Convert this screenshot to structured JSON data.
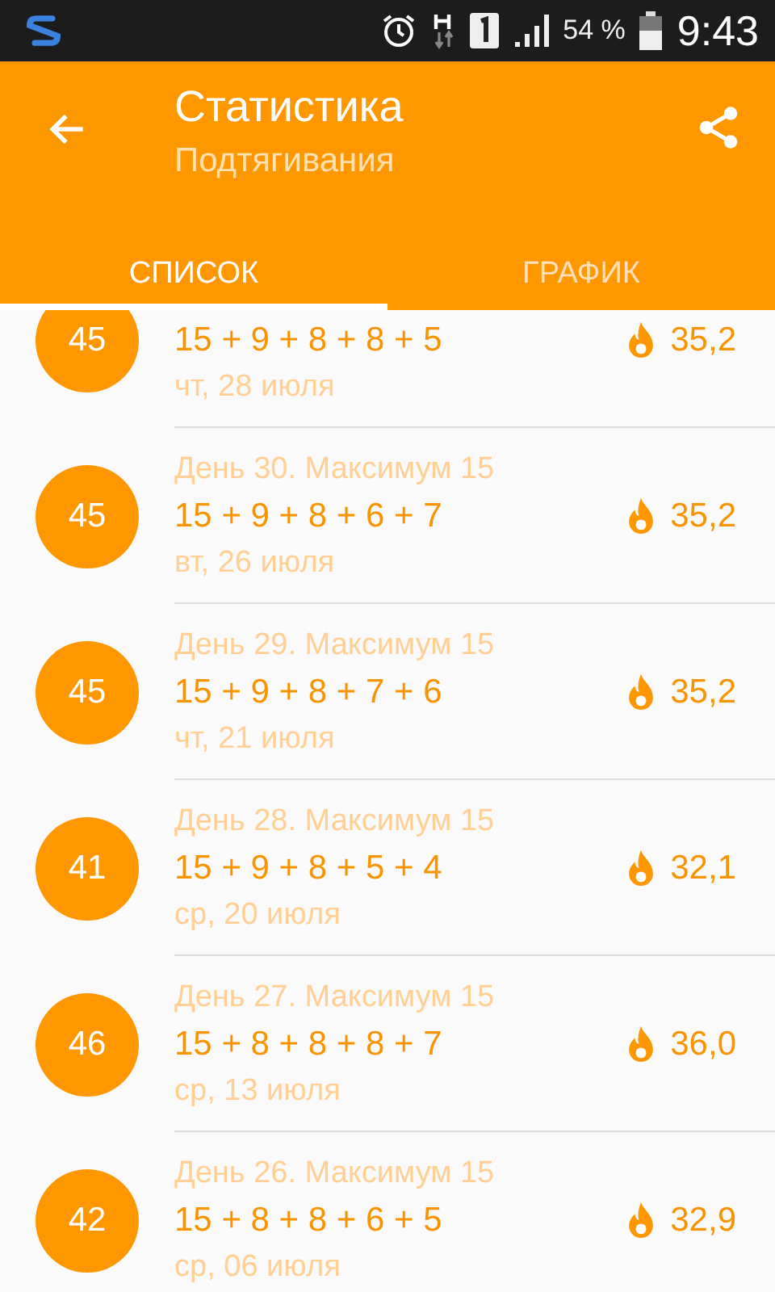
{
  "status_bar": {
    "battery_text": "54 %",
    "time": "9:43"
  },
  "app_bar": {
    "title": "Статистика",
    "subtitle": "Подтягивания"
  },
  "tabs": [
    {
      "label": "СПИСОК",
      "selected": true
    },
    {
      "label": "ГРАФИК",
      "selected": false
    }
  ],
  "entries": [
    {
      "total": "45",
      "sets": "15 + 9 + 8 + 8 + 5",
      "date": "чт, 28 июля",
      "score": "35,2"
    },
    {
      "total": "45",
      "header": "День 30.  Максимум 15",
      "sets": "15 + 9 + 8 + 6 + 7",
      "date": "вт, 26 июля",
      "score": "35,2"
    },
    {
      "total": "45",
      "header": "День 29.  Максимум 15",
      "sets": "15 + 9 + 8 + 7 + 6",
      "date": "чт, 21 июля",
      "score": "35,2"
    },
    {
      "total": "41",
      "header": "День 28.  Максимум 15",
      "sets": "15 + 9 + 8 + 5 + 4",
      "date": "ср, 20 июля",
      "score": "32,1"
    },
    {
      "total": "46",
      "header": "День 27.  Максимум 15",
      "sets": "15 + 8 + 8 + 8 + 7",
      "date": "ср, 13 июля",
      "score": "36,0"
    },
    {
      "total": "42",
      "header": "День 26.  Максимум 15",
      "sets": "15 + 8 + 8 + 6 + 5",
      "date": "ср, 06 июля",
      "score": "32,9"
    }
  ]
}
